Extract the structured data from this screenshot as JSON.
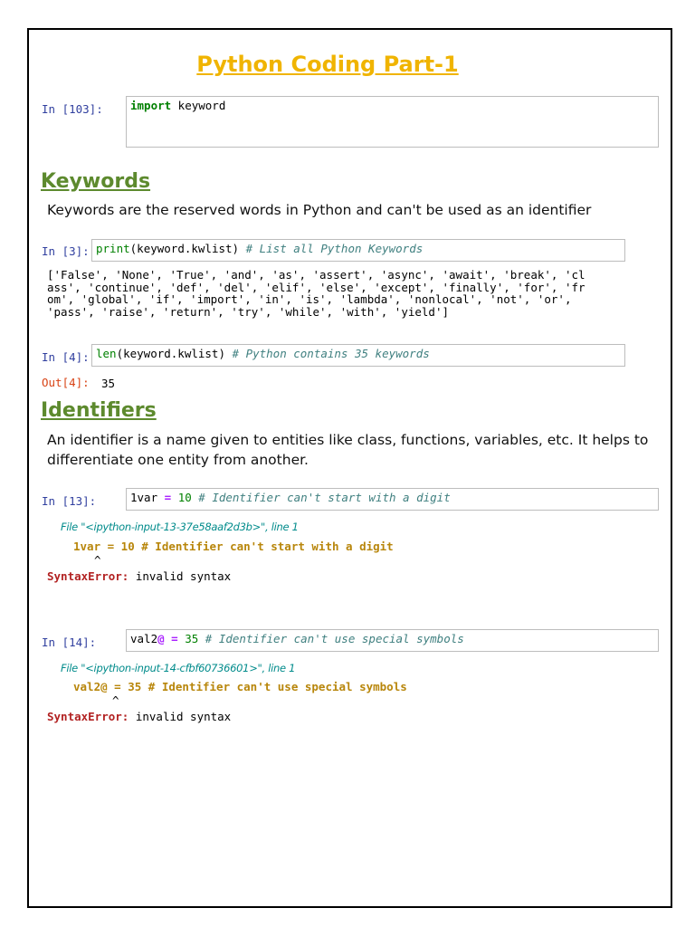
{
  "title": "Python Coding Part-1",
  "cells": {
    "c103": {
      "prompt": "In [103]:",
      "kw": "import",
      "rest": " keyword"
    },
    "c3": {
      "prompt": "In [3]:",
      "fn": "print",
      "code": "(keyword.kwlist) ",
      "comment": "# List all Python Keywords",
      "output": "['False', 'None', 'True', 'and', 'as', 'assert', 'async', 'await', 'break', 'cl\nass', 'continue', 'def', 'del', 'elif', 'else', 'except', 'finally', 'for', 'fr\nom', 'global', 'if', 'import', 'in', 'is', 'lambda', 'nonlocal', 'not', 'or',\n'pass', 'raise', 'return', 'try', 'while', 'with', 'yield']"
    },
    "c4": {
      "prompt": "In [4]:",
      "fn": "len",
      "code": "(keyword.kwlist) ",
      "comment": "# Python contains 35 keywords",
      "out_prompt": "Out[4]:",
      "out_value": "35"
    },
    "c13": {
      "prompt": "In [13]:",
      "var": "1var ",
      "op": "=",
      "num": " 10 ",
      "comment": "# Identifier can't start with a digit",
      "trace_file": "File \"<ipython-input-13-37e58aaf2d3b>\", line 1",
      "trace_code": "1var = 10 # Identifier can't start with a digit",
      "caret": "^",
      "err_name": "SyntaxError:",
      "err_text": " invalid syntax"
    },
    "c14": {
      "prompt": "In [14]:",
      "var": "val2",
      "op": "@ =",
      "num": " 35 ",
      "comment": "# Identifier can't use special symbols",
      "trace_file": "File \"<ipython-input-14-cfbf60736601>\", line 1",
      "trace_code": "val2@ = 35 # Identifier can't use special symbols",
      "caret": "^",
      "err_name": "SyntaxError:",
      "err_text": " invalid syntax"
    }
  },
  "sections": {
    "keywords": {
      "heading": "Keywords",
      "text": "Keywords are the reserved words in Python and can't be used as an identifier"
    },
    "identifiers": {
      "heading": "Identifiers",
      "text": "An identifier is a name given to entities like class, functions, variables, etc. It helps to differentiate one entity from another."
    }
  }
}
